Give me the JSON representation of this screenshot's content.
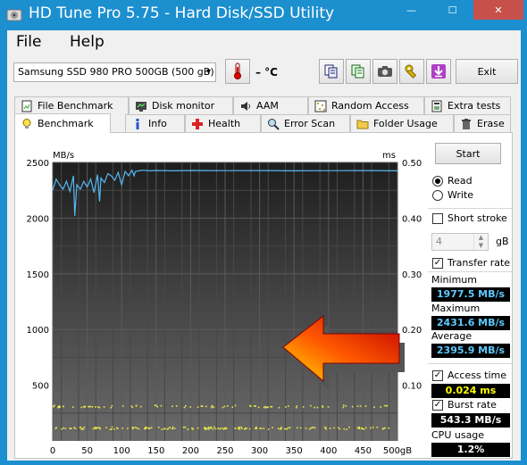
{
  "window": {
    "title": "HD Tune Pro 5.75 - Hard Disk/SSD Utility",
    "controls": {
      "minimize": "—",
      "maximize": "☐",
      "close": "✕"
    }
  },
  "menu": {
    "file": "File",
    "help": "Help"
  },
  "toolbar": {
    "device": "Samsung SSD 980 PRO 500GB (500 gB)",
    "temperature": "– °C",
    "exit_label": "Exit",
    "icons": [
      "copy-info-icon",
      "copy-all-icon",
      "screenshot-camera-icon",
      "options-wrench-icon",
      "save-down-arrow-icon"
    ]
  },
  "tabs": {
    "back_row": [
      "File Benchmark",
      "Disk monitor",
      "AAM",
      "Random Access",
      "Extra tests"
    ],
    "front_row": [
      "Benchmark",
      "Info",
      "Health",
      "Error Scan",
      "Folder Usage",
      "Erase"
    ],
    "active": "Benchmark"
  },
  "controls": {
    "start_label": "Start",
    "read_label": "Read",
    "write_label": "Write",
    "mode_selected": "Read",
    "short_stroke_label": "Short stroke",
    "short_stroke_checked": false,
    "short_stroke_value": "4",
    "short_stroke_unit": "gB",
    "transfer_rate_label": "Transfer rate",
    "transfer_rate_checked": true,
    "access_time_label": "Access time",
    "access_time_checked": true,
    "burst_rate_label": "Burst rate",
    "burst_rate_checked": true
  },
  "results": {
    "minimum_label": "Minimum",
    "minimum_value": "1977.5 MB/s",
    "maximum_label": "Maximum",
    "maximum_value": "2431.6 MB/s",
    "average_label": "Average",
    "average_value": "2395.9 MB/s",
    "access_time_value": "0.024 ms",
    "burst_rate_value": "543.3 MB/s",
    "cpu_usage_label": "CPU usage",
    "cpu_usage_value": "1.2%"
  },
  "colors": {
    "titlebar": "#1c8fcf",
    "close": "#c7504b",
    "chart_bg": "#333333",
    "transfer_line": "#55b8f0",
    "access_points": "#e6e64a",
    "value_blue": "#5cc9ff",
    "value_yellow": "#ffff00",
    "value_white": "#ffffff"
  },
  "chart_data": {
    "type": "line",
    "left_unit": "MB/s",
    "right_unit": "ms",
    "x_unit": "gB",
    "x_ticks": [
      "0",
      "50",
      "100",
      "150",
      "200",
      "250",
      "300",
      "350",
      "400",
      "450",
      "500gB"
    ],
    "y_ticks_left": [
      "2500",
      "2000",
      "1500",
      "1000",
      "500"
    ],
    "y_ticks_right": [
      "0.50",
      "0.40",
      "0.30",
      "0.20",
      "0.10"
    ],
    "xlim": [
      0,
      500
    ],
    "ylim_left": [
      0,
      2500
    ],
    "ylim_right": [
      0,
      0.5
    ],
    "series": [
      {
        "kind": "transfer-rate",
        "x": [
          0,
          5,
          10,
          15,
          20,
          25,
          30,
          32,
          35,
          40,
          45,
          50,
          55,
          60,
          65,
          68,
          70,
          75,
          80,
          85,
          90,
          95,
          100,
          105,
          110,
          115,
          118,
          120,
          125,
          130,
          140,
          150,
          175,
          200,
          250,
          300,
          350,
          400,
          450,
          500
        ],
        "y": [
          2250,
          2350,
          2300,
          2260,
          2330,
          2240,
          2380,
          2020,
          2300,
          2260,
          2330,
          2280,
          2350,
          2230,
          2390,
          2150,
          2360,
          2320,
          2400,
          2380,
          2340,
          2410,
          2300,
          2420,
          2380,
          2430,
          2380,
          2420,
          2425,
          2430,
          2425,
          2428,
          2425,
          2428,
          2426,
          2427,
          2425,
          2426,
          2427,
          2425
        ]
      },
      {
        "kind": "access-time-band-1",
        "x_range": [
          0,
          500
        ],
        "y_ms": 0.024
      },
      {
        "kind": "access-time-band-2",
        "x_range": [
          0,
          500
        ],
        "y_ms": 0.063
      }
    ]
  }
}
